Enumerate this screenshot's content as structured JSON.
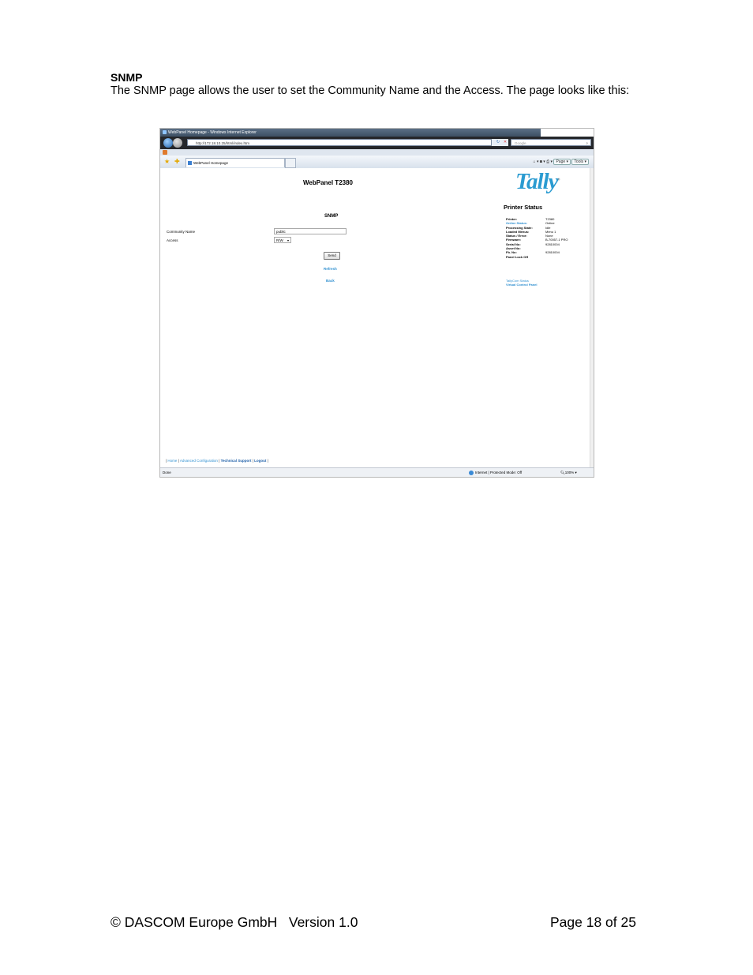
{
  "document": {
    "heading": "SNMP",
    "intro": "The SNMP page allows the user to set the Community Name and the Access.  The page looks like this:",
    "footer_left": "© DASCOM Europe GmbH   Version 1.0",
    "footer_right": "Page 18 of 25"
  },
  "browser": {
    "window_title": "WebPanel Homepage - Windows Internet Explorer",
    "address": "http://172.18.10.25/html/index.htm",
    "search_placeholder": "Google",
    "tab_label": "WebPanel Homepage",
    "toolbar": {
      "page_label": "Page ▾",
      "tools_label": "Tools ▾"
    },
    "status": {
      "left": "Done",
      "zone": "Internet | Protected Mode: Off",
      "zoom": "100%"
    }
  },
  "webpanel": {
    "title": "WebPanel T2380",
    "logo_text": "Tally",
    "logo_mark": "®",
    "printer_status": {
      "title": "Printer Status",
      "rows": [
        {
          "label": "Printer:",
          "value": "T2380",
          "label_style": "bold"
        },
        {
          "label": "Online Status:",
          "value": "Online",
          "label_style": "blue"
        },
        {
          "label": "Processing State:",
          "value": "Idle",
          "label_style": "bold"
        },
        {
          "label": "Loaded Menus:",
          "value": "Menu 1",
          "label_style": "bold"
        },
        {
          "label": "Status / Error:",
          "value": "None",
          "label_style": "bold"
        },
        {
          "label": "Firmware:",
          "value": "B-70057-1 PRO",
          "label_style": "bold"
        },
        {
          "label": "Serial No:",
          "value": "92810004",
          "label_style": "bold"
        },
        {
          "label": "Asset No:",
          "value": "",
          "label_style": "bold"
        },
        {
          "label": "Fb. No:",
          "value": "92810004",
          "label_style": "bold"
        },
        {
          "label": "Panel Lock Off",
          "value": "",
          "label_style": "bold"
        }
      ],
      "link_tallycom": "TallyCom Status",
      "link_vcp": "Virtual Control Panel"
    },
    "snmp": {
      "title": "SNMP",
      "community_label": "Community Name",
      "community_value": "public",
      "access_label": "Access",
      "access_value": "R/W",
      "send_label": "Send",
      "refresh_label": "Refresh",
      "back_label": "Back"
    },
    "footer_nav": {
      "home": "Home",
      "advanced": "Advanced Configuration",
      "support": "Technical Support",
      "logout": "Logout"
    }
  }
}
